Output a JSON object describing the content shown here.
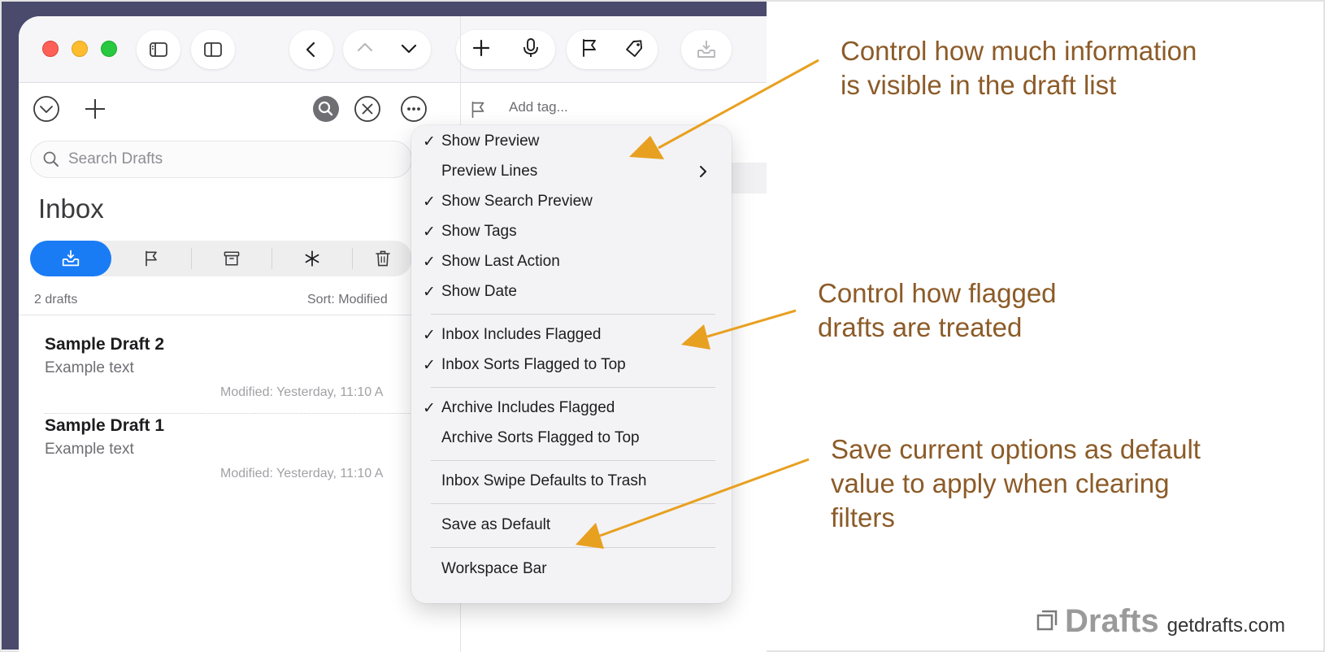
{
  "search": {
    "placeholder": "Search Drafts"
  },
  "list": {
    "title": "Inbox",
    "count_label": "2 drafts",
    "sort_label": "Sort: Modified",
    "drafts": [
      {
        "title": "Sample Draft 2",
        "body": "Example text",
        "modified": "Modified: Yesterday, 11:10 A"
      },
      {
        "title": "Sample Draft 1",
        "body": "Example text",
        "modified": "Modified: Yesterday, 11:10 A"
      }
    ]
  },
  "editor": {
    "add_tag_placeholder": "Add tag..."
  },
  "menu": {
    "items": [
      {
        "label": "Show Preview",
        "checked": true,
        "check": "✓"
      },
      {
        "label": "Preview Lines",
        "checked": false,
        "submenu": true
      },
      {
        "label": "Show Search Preview",
        "checked": true,
        "check": "✓"
      },
      {
        "label": "Show Tags",
        "checked": true,
        "check": "✓"
      },
      {
        "label": "Show Last Action",
        "checked": true,
        "check": "✓"
      },
      {
        "label": "Show Date",
        "checked": true,
        "check": "✓"
      },
      {
        "label": "Inbox Includes Flagged",
        "checked": true,
        "check": "✓"
      },
      {
        "label": "Inbox Sorts Flagged to Top",
        "checked": true,
        "check": "✓"
      },
      {
        "label": "Archive Includes Flagged",
        "checked": true,
        "check": "✓"
      },
      {
        "label": "Archive Sorts Flagged to Top",
        "checked": false
      },
      {
        "label": "Inbox Swipe Defaults to Trash",
        "checked": false
      },
      {
        "label": "Save as Default",
        "checked": false
      },
      {
        "label": "Workspace Bar",
        "checked": false
      }
    ]
  },
  "annotations": {
    "info": [
      "Control how much information",
      "is visible in the draft list"
    ],
    "flagged": [
      "Control how flagged",
      "drafts are treated"
    ],
    "defaults": [
      "Save current options as default",
      "value to apply when clearing",
      "filters"
    ]
  },
  "brand": {
    "name": "Drafts",
    "url": "getdrafts.com"
  },
  "colors": {
    "accent": "#1a7cf5",
    "annotation_text": "#8c5b28",
    "arrow": "#e8a021",
    "desktop": "#4a4a6d"
  },
  "icons": [
    "sidebar-icon",
    "panel-icon",
    "chevron-left-icon",
    "chevron-up-icon",
    "chevron-down-icon",
    "plus-icon",
    "microphone-icon",
    "flag-icon",
    "tag-icon",
    "tray-import-icon",
    "circle-chevron-down-icon",
    "search-filled-icon",
    "circle-x-icon",
    "ellipsis-icon",
    "magnifier-icon",
    "inbox-icon",
    "archive-icon",
    "asterisk-icon",
    "trash-icon",
    "chevron-right-icon",
    "drafts-logo-icon"
  ]
}
